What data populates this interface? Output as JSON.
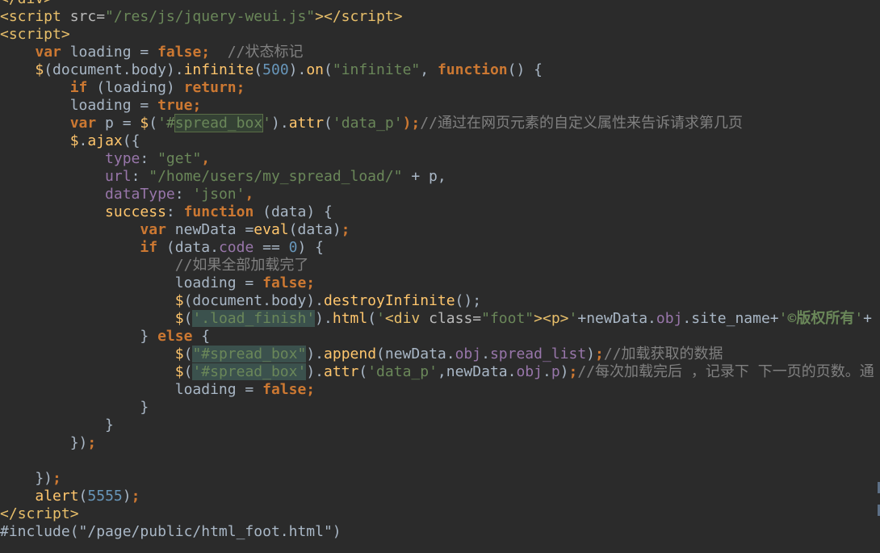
{
  "editor": {
    "lines": [
      [
        {
          "t": "</div>",
          "c": "tag"
        }
      ],
      [
        {
          "t": "<script",
          "c": "tag"
        },
        {
          "t": " src=",
          "c": "attr"
        },
        {
          "t": "\"/res/js/jquery-weui.js\"",
          "c": "str"
        },
        {
          "t": "></",
          "c": "tag"
        },
        {
          "t": "script",
          "c": "tag"
        },
        {
          "t": ">",
          "c": "tag"
        }
      ],
      [
        {
          "t": "<script>",
          "c": "tag"
        }
      ],
      [
        {
          "t": "    ",
          "c": "plain"
        },
        {
          "t": "var",
          "c": "kw"
        },
        {
          "t": " loading = ",
          "c": "plain"
        },
        {
          "t": "false",
          "c": "kw"
        },
        {
          "t": ";",
          "c": "kw"
        },
        {
          "t": "  //状态标记",
          "c": "cmt"
        }
      ],
      [
        {
          "t": "    ",
          "c": "plain"
        },
        {
          "t": "$",
          "c": "fn"
        },
        {
          "t": "(document.body).",
          "c": "plain"
        },
        {
          "t": "infinite",
          "c": "fn"
        },
        {
          "t": "(",
          "c": "plain"
        },
        {
          "t": "500",
          "c": "num"
        },
        {
          "t": ").",
          "c": "plain"
        },
        {
          "t": "on",
          "c": "fn"
        },
        {
          "t": "(",
          "c": "plain"
        },
        {
          "t": "\"infinite\"",
          "c": "str"
        },
        {
          "t": ", ",
          "c": "plain"
        },
        {
          "t": "function",
          "c": "kw"
        },
        {
          "t": "() {",
          "c": "plain"
        }
      ],
      [
        {
          "t": "        ",
          "c": "plain"
        },
        {
          "t": "if",
          "c": "kw"
        },
        {
          "t": " (loading) ",
          "c": "plain"
        },
        {
          "t": "return",
          "c": "kw"
        },
        {
          "t": ";",
          "c": "kw"
        }
      ],
      [
        {
          "t": "        loading = ",
          "c": "plain"
        },
        {
          "t": "true",
          "c": "kw"
        },
        {
          "t": ";",
          "c": "kw"
        }
      ],
      [
        {
          "t": "        ",
          "c": "plain"
        },
        {
          "t": "var",
          "c": "kw"
        },
        {
          "t": " p = ",
          "c": "plain"
        },
        {
          "t": "$",
          "c": "fn"
        },
        {
          "t": "(",
          "c": "plain"
        },
        {
          "t": "'#",
          "c": "str"
        },
        {
          "t": "spread_box",
          "c": "str hl"
        },
        {
          "t": "'",
          "c": "str"
        },
        {
          "t": ").",
          "c": "plain"
        },
        {
          "t": "attr",
          "c": "fn"
        },
        {
          "t": "(",
          "c": "plain"
        },
        {
          "t": "'data_p'",
          "c": "str"
        },
        {
          "t": ");",
          "c": "kw"
        },
        {
          "t": "//通过在网页元素的自定义属性来告诉请求第几页",
          "c": "cmt"
        }
      ],
      [
        {
          "t": "        ",
          "c": "plain"
        },
        {
          "t": "$",
          "c": "fn"
        },
        {
          "t": ".",
          "c": "plain"
        },
        {
          "t": "ajax",
          "c": "fn"
        },
        {
          "t": "({",
          "c": "plain"
        }
      ],
      [
        {
          "t": "            ",
          "c": "plain"
        },
        {
          "t": "type",
          "c": "prop"
        },
        {
          "t": ": ",
          "c": "plain"
        },
        {
          "t": "\"get\"",
          "c": "str"
        },
        {
          "t": ",",
          "c": "kw"
        }
      ],
      [
        {
          "t": "            ",
          "c": "plain"
        },
        {
          "t": "url",
          "c": "prop"
        },
        {
          "t": ": ",
          "c": "plain"
        },
        {
          "t": "\"/home/users/my_spread_load/\"",
          "c": "str"
        },
        {
          "t": " + p,",
          "c": "plain"
        }
      ],
      [
        {
          "t": "            ",
          "c": "plain"
        },
        {
          "t": "dataType",
          "c": "prop"
        },
        {
          "t": ": ",
          "c": "plain"
        },
        {
          "t": "'json'",
          "c": "str"
        },
        {
          "t": ",",
          "c": "kw"
        }
      ],
      [
        {
          "t": "            ",
          "c": "plain"
        },
        {
          "t": "success",
          "c": "fn"
        },
        {
          "t": ": ",
          "c": "plain"
        },
        {
          "t": "function",
          "c": "kw"
        },
        {
          "t": " (data) {",
          "c": "plain"
        }
      ],
      [
        {
          "t": "                ",
          "c": "plain"
        },
        {
          "t": "var",
          "c": "kw"
        },
        {
          "t": " newData =",
          "c": "plain"
        },
        {
          "t": "eval",
          "c": "fn"
        },
        {
          "t": "(data)",
          "c": "plain"
        },
        {
          "t": ";",
          "c": "kw"
        }
      ],
      [
        {
          "t": "                ",
          "c": "plain"
        },
        {
          "t": "if",
          "c": "kw"
        },
        {
          "t": " (data.",
          "c": "plain"
        },
        {
          "t": "code",
          "c": "prop"
        },
        {
          "t": " == ",
          "c": "plain"
        },
        {
          "t": "0",
          "c": "num"
        },
        {
          "t": ") {",
          "c": "plain"
        }
      ],
      [
        {
          "t": "                    //如果全部加载完了",
          "c": "cmt"
        }
      ],
      [
        {
          "t": "                    loading = ",
          "c": "plain"
        },
        {
          "t": "false",
          "c": "kw"
        },
        {
          "t": ";",
          "c": "kw"
        }
      ],
      [
        {
          "t": "                    ",
          "c": "plain"
        },
        {
          "t": "$",
          "c": "fn"
        },
        {
          "t": "(document.body).",
          "c": "plain"
        },
        {
          "t": "destroyInfinite",
          "c": "fn"
        },
        {
          "t": "();",
          "c": "plain"
        }
      ],
      [
        {
          "t": "                    ",
          "c": "plain"
        },
        {
          "t": "$",
          "c": "fn"
        },
        {
          "t": "(",
          "c": "plain"
        },
        {
          "t": "'",
          "c": "str hl2"
        },
        {
          "t": ".load_finish",
          "c": "str hl2"
        },
        {
          "t": "'",
          "c": "str hl2"
        },
        {
          "t": ").",
          "c": "plain"
        },
        {
          "t": "html",
          "c": "fn"
        },
        {
          "t": "(",
          "c": "plain"
        },
        {
          "t": "'",
          "c": "str"
        },
        {
          "t": "<div",
          "c": "tag"
        },
        {
          "t": " class=",
          "c": "attr"
        },
        {
          "t": "\"foot\"",
          "c": "str"
        },
        {
          "t": "><p>",
          "c": "tag"
        },
        {
          "t": "'",
          "c": "str"
        },
        {
          "t": "+newData.",
          "c": "plain"
        },
        {
          "t": "obj",
          "c": "prop"
        },
        {
          "t": ".site_name+",
          "c": "plain"
        },
        {
          "t": "'",
          "c": "str"
        },
        {
          "t": "©版权所有",
          "c": "str bold"
        },
        {
          "t": "'",
          "c": "str"
        },
        {
          "t": "+",
          "c": "plain"
        }
      ],
      [
        {
          "t": "                } ",
          "c": "plain"
        },
        {
          "t": "else",
          "c": "kw"
        },
        {
          "t": " {",
          "c": "plain"
        }
      ],
      [
        {
          "t": "                    ",
          "c": "plain"
        },
        {
          "t": "$",
          "c": "fn"
        },
        {
          "t": "(",
          "c": "plain"
        },
        {
          "t": "\"#spread_box\"",
          "c": "str hl2"
        },
        {
          "t": ").",
          "c": "plain"
        },
        {
          "t": "append",
          "c": "fn"
        },
        {
          "t": "(newData.",
          "c": "plain"
        },
        {
          "t": "obj",
          "c": "prop"
        },
        {
          "t": ".",
          "c": "plain"
        },
        {
          "t": "spread_list",
          "c": "prop"
        },
        {
          "t": ")",
          "c": "plain"
        },
        {
          "t": ";",
          "c": "kw"
        },
        {
          "t": "//加载获取的数据",
          "c": "cmt"
        }
      ],
      [
        {
          "t": "                    ",
          "c": "plain"
        },
        {
          "t": "$",
          "c": "fn"
        },
        {
          "t": "(",
          "c": "plain"
        },
        {
          "t": "'#spread_box'",
          "c": "str hl2"
        },
        {
          "t": ").",
          "c": "plain"
        },
        {
          "t": "attr",
          "c": "fn"
        },
        {
          "t": "(",
          "c": "plain"
        },
        {
          "t": "'data_p'",
          "c": "str"
        },
        {
          "t": ",newData.",
          "c": "plain"
        },
        {
          "t": "obj",
          "c": "prop"
        },
        {
          "t": ".",
          "c": "plain"
        },
        {
          "t": "p",
          "c": "prop"
        },
        {
          "t": ")",
          "c": "plain"
        },
        {
          "t": ";",
          "c": "kw"
        },
        {
          "t": "//每次加载完后 ，记录下 下一页的页数。通",
          "c": "cmt"
        }
      ],
      [
        {
          "t": "                    loading = ",
          "c": "plain"
        },
        {
          "t": "false",
          "c": "kw"
        },
        {
          "t": ";",
          "c": "kw"
        }
      ],
      [
        {
          "t": "                }",
          "c": "plain"
        }
      ],
      [
        {
          "t": "            }",
          "c": "plain"
        }
      ],
      [
        {
          "t": "        })",
          "c": "plain"
        },
        {
          "t": ";",
          "c": "kw"
        }
      ],
      [
        {
          "t": "",
          "c": "plain"
        }
      ],
      [
        {
          "t": "    })",
          "c": "plain"
        },
        {
          "t": ";",
          "c": "kw"
        }
      ],
      [
        {
          "t": "    ",
          "c": "plain"
        },
        {
          "t": "alert",
          "c": "fn"
        },
        {
          "t": "(",
          "c": "plain"
        },
        {
          "t": "5555",
          "c": "num"
        },
        {
          "t": ")",
          "c": "plain"
        },
        {
          "t": ";",
          "c": "kw"
        }
      ],
      [
        {
          "t": "</",
          "c": "tag"
        },
        {
          "t": "script",
          "c": "tag"
        },
        {
          "t": ">",
          "c": "tag"
        }
      ],
      [
        {
          "t": "#include(\"/page/public/html_foot.html\")",
          "c": "plain"
        }
      ]
    ]
  },
  "colors": {
    "background": "#2b2b2b",
    "tag": "#e8bf6a",
    "string": "#6a8759",
    "keyword": "#cc7832",
    "function": "#ffc66d",
    "number": "#6897bb",
    "property": "#9876aa",
    "comment": "#808080",
    "plain": "#a9b7c6"
  }
}
